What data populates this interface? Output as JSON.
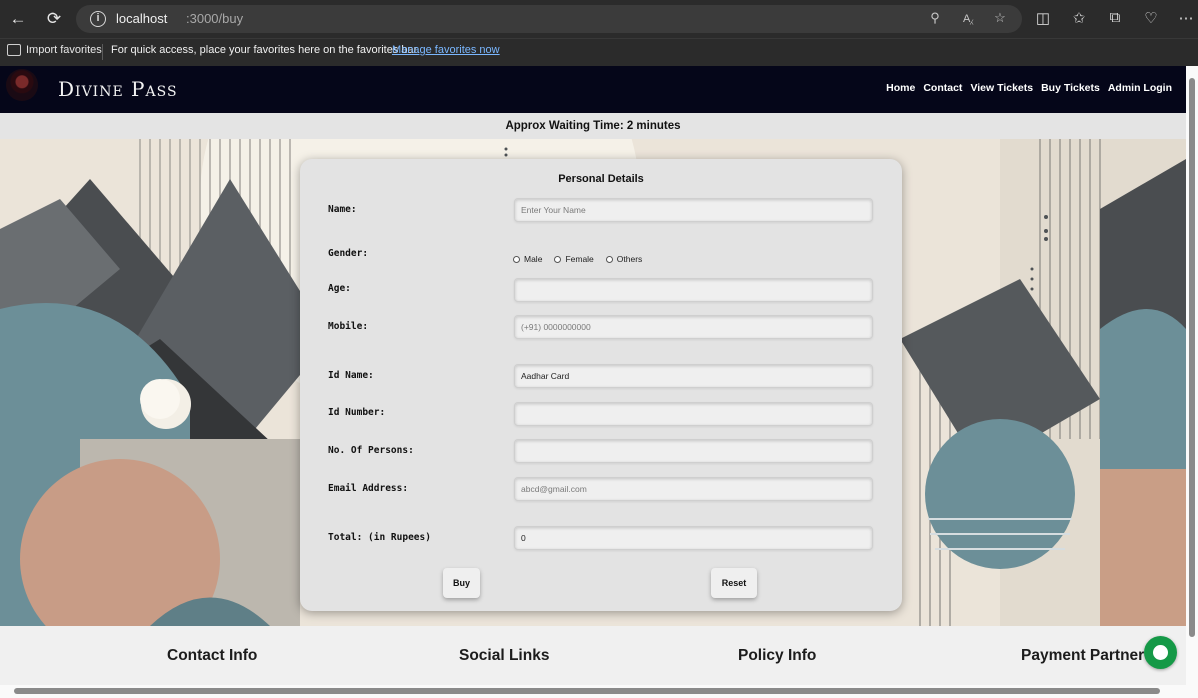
{
  "browser": {
    "url_host": "localhost",
    "url_path": ":3000/buy",
    "favorites": {
      "import_label": "Import favorites",
      "message": "For quick access, place your favorites here on the favorites bar.",
      "manage_link": "Manage favorites now"
    }
  },
  "header": {
    "brand": "Divine Pass",
    "nav": [
      "Home",
      "Contact",
      "View Tickets",
      "Buy Tickets",
      "Admin Login"
    ]
  },
  "wait_time": "Approx Waiting Time: 2 minutes",
  "form": {
    "title": "Personal Details",
    "fields": {
      "name": {
        "label": "Name:",
        "placeholder": "Enter Your Name"
      },
      "gender": {
        "label": "Gender:",
        "options": [
          "Male",
          "Female",
          "Others"
        ]
      },
      "age": {
        "label": "Age:"
      },
      "mobile": {
        "label": "Mobile:",
        "placeholder": "(+91) 0000000000"
      },
      "id_name": {
        "label": "Id Name:",
        "value": "Aadhar Card"
      },
      "id_number": {
        "label": "Id Number:"
      },
      "persons": {
        "label": "No. Of Persons:"
      },
      "email": {
        "label": "Email Address:",
        "placeholder": "abcd@gmail.com"
      },
      "total": {
        "label": "Total: (in Rupees)",
        "value": "0"
      }
    },
    "buy_label": "Buy",
    "reset_label": "Reset"
  },
  "footer": {
    "headings": [
      "Contact Info",
      "Social Links",
      "Policy Info",
      "Payment Partner"
    ]
  },
  "colors": {
    "header_bg": "#050619",
    "chat_green": "#159947",
    "link_blue": "#7ab7ff"
  }
}
